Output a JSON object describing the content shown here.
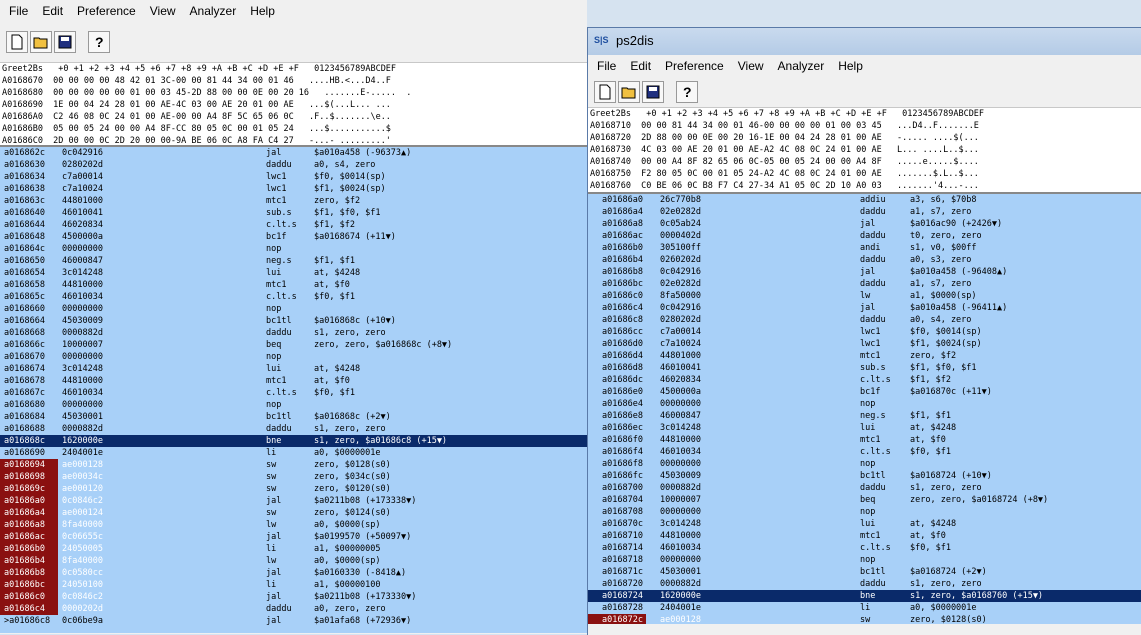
{
  "win1": {
    "title": "ps2dis",
    "menu": [
      "File",
      "Edit",
      "Preference",
      "View",
      "Analyzer",
      "Help"
    ],
    "hex_header": "Greet2Bs   +0 +1 +2 +3 +4 +5 +6 +7 +8 +9 +A +B +C +D +E +F   0123456789ABCDEF",
    "hex_rows": [
      "A0168670  00 00 00 00 48 42 01 3C-00 00 81 44 34 00 01 46   ....HB.<...D4..F",
      "A0168680  00 00 00 00 00 01 00 03 45-2D 88 00 00 0E 00 20 16   .......E-.....  .",
      "A0168690  1E 00 04 24 28 01 00 AE-4C 03 00 AE 20 01 00 AE   ...$(...L... ...",
      "A01686A0  C2 46 08 0C 24 01 00 AE-00 00 A4 8F 5C 65 06 0C   .F..$.......\\e..",
      "A01686B0  05 00 05 24 00 00 A4 8F-CC 80 05 0C 00 01 05 24   ...$...........$",
      "A01686C0  2D 00 00 0C 2D 20 00 00-9A BE 06 0C A8 FA C4 27   -...- .........'"
    ],
    "rows": [
      {
        "a": "a016862c",
        "h": "0c042916",
        "m": "jal",
        "o": "$a010a458 (-96373▲)"
      },
      {
        "a": "a0168630",
        "h": "0280202d",
        "m": "daddu",
        "o": "a0, s4, zero"
      },
      {
        "a": "a0168634",
        "h": "c7a00014",
        "m": "lwc1",
        "o": "$f0, $0014(sp)"
      },
      {
        "a": "a0168638",
        "h": "c7a10024",
        "m": "lwc1",
        "o": "$f1, $0024(sp)"
      },
      {
        "a": "a016863c",
        "h": "44801000",
        "m": "mtc1",
        "o": "zero, $f2"
      },
      {
        "a": "a0168640",
        "h": "46010041",
        "m": "sub.s",
        "o": "$f1, $f0, $f1"
      },
      {
        "a": "a0168644",
        "h": "46020834",
        "m": "c.lt.s",
        "o": "$f1, $f2"
      },
      {
        "a": "a0168648",
        "h": "4500000a",
        "m": "bc1f",
        "o": "$a0168674 (+11▼)"
      },
      {
        "a": "a016864c",
        "h": "00000000",
        "m": "nop",
        "o": ""
      },
      {
        "a": "a0168650",
        "h": "46000847",
        "m": "neg.s",
        "o": "$f1, $f1"
      },
      {
        "a": "a0168654",
        "h": "3c014248",
        "m": "lui",
        "o": "at, $4248"
      },
      {
        "a": "a0168658",
        "h": "44810000",
        "m": "mtc1",
        "o": "at, $f0"
      },
      {
        "a": "a016865c",
        "h": "46010034",
        "m": "c.lt.s",
        "o": "$f0, $f1"
      },
      {
        "a": "a0168660",
        "h": "00000000",
        "m": "nop",
        "o": ""
      },
      {
        "a": "a0168664",
        "h": "45030009",
        "m": "bc1tl",
        "o": "$a016868c (+10▼)"
      },
      {
        "a": "a0168668",
        "h": "0000882d",
        "m": "daddu",
        "o": "s1, zero, zero"
      },
      {
        "a": "a016866c",
        "h": "10000007",
        "m": "beq",
        "o": "zero, zero, $a016868c (+8▼)"
      },
      {
        "a": "a0168670",
        "h": "00000000",
        "m": "nop",
        "o": ""
      },
      {
        "a": "a0168674",
        "h": "3c014248",
        "m": "lui",
        "o": "at, $4248"
      },
      {
        "a": "a0168678",
        "h": "44810000",
        "m": "mtc1",
        "o": "at, $f0"
      },
      {
        "a": "a016867c",
        "h": "46010034",
        "m": "c.lt.s",
        "o": "$f0, $f1"
      },
      {
        "a": "a0168680",
        "h": "00000000",
        "m": "nop",
        "o": ""
      },
      {
        "a": "a0168684",
        "h": "45030001",
        "m": "bc1tl",
        "o": "$a016868c (+2▼)"
      },
      {
        "a": "a0168688",
        "h": "0000882d",
        "m": "daddu",
        "o": "s1, zero, zero"
      },
      {
        "a": "a016868c",
        "h": "1620000e",
        "m": "bne",
        "o": "s1, zero, $a01686c8 (+15▼)",
        "sel": true
      },
      {
        "a": "a0168690",
        "h": "2404001e",
        "m": "li",
        "o": "a0, $0000001e"
      },
      {
        "a": "a0168694",
        "h": "ae000128",
        "m": "sw",
        "o": "zero, $0128(s0)",
        "red": true
      },
      {
        "a": "a0168698",
        "h": "ae00034c",
        "m": "sw",
        "o": "zero, $034c(s0)",
        "red": true
      },
      {
        "a": "a016869c",
        "h": "ae000120",
        "m": "sw",
        "o": "zero, $0120(s0)",
        "red": true
      },
      {
        "a": "a01686a0",
        "h": "0c0846c2",
        "m": "jal",
        "o": "$a0211b08 (+173338▼)",
        "red": true
      },
      {
        "a": "a01686a4",
        "h": "ae000124",
        "m": "sw",
        "o": "zero, $0124(s0)",
        "red": true
      },
      {
        "a": "a01686a8",
        "h": "8fa40000",
        "m": "lw",
        "o": "a0, $0000(sp)",
        "red": true
      },
      {
        "a": "a01686ac",
        "h": "0c06655c",
        "m": "jal",
        "o": "$a0199570 (+50097▼)",
        "red": true
      },
      {
        "a": "a01686b0",
        "h": "24050005",
        "m": "li",
        "o": "a1, $00000005",
        "red": true
      },
      {
        "a": "a01686b4",
        "h": "8fa40000",
        "m": "lw",
        "o": "a0, $0000(sp)",
        "red": true
      },
      {
        "a": "a01686b8",
        "h": "0c0580cc",
        "m": "jal",
        "o": "$a0160330 (-8418▲)",
        "red": true
      },
      {
        "a": "a01686bc",
        "h": "24050100",
        "m": "li",
        "o": "a1, $00000100",
        "red": true
      },
      {
        "a": "a01686c0",
        "h": "0c0846c2",
        "m": "jal",
        "o": "$a0211b08 (+173330▼)",
        "red": true
      },
      {
        "a": "a01686c4",
        "h": "0000202d",
        "m": "daddu",
        "o": "a0, zero, zero",
        "red": true
      },
      {
        "a": ">a01686c8",
        "h": "0c06be9a",
        "m": "jal",
        "o": "$a01afa68 (+72936▼)"
      }
    ]
  },
  "win2": {
    "title": "ps2dis",
    "menu": [
      "File",
      "Edit",
      "Preference",
      "View",
      "Analyzer",
      "Help"
    ],
    "hex_header": "Greet2Bs   +0 +1 +2 +3 +4 +5 +6 +7 +8 +9 +A +B +C +D +E +F   0123456789ABCDEF",
    "hex_rows": [
      "A0168710  00 00 81 44 34 00 01 46-00 00 00 00 01 00 03 45   ...D4..F.......E",
      "A0168720  2D 88 00 00 0E 00 20 16-1E 00 04 24 28 01 00 AE   -..... ....$(...",
      "A0168730  4C 03 00 AE 20 01 00 AE-A2 4C 08 0C 24 01 00 AE   L... ....L..$...",
      "A0168740  00 00 A4 8F 82 65 06 0C-05 00 05 24 00 00 A4 8F   .....e.....$....",
      "A0168750  F2 80 05 0C 00 01 05 24-A2 4C 08 0C 24 01 00 AE   .......$.L..$...",
      "A0168760  C0 BE 06 0C B8 F7 C4 27-34 A1 05 0C 2D 10 A0 03   .......'4...-..."
    ],
    "rows": [
      {
        "a": "a01686a0",
        "h": "26c770b8",
        "m": "addiu",
        "o": "a3, s6, $70b8"
      },
      {
        "a": "a01686a4",
        "h": "02e0282d",
        "m": "daddu",
        "o": "a1, s7, zero"
      },
      {
        "a": "a01686a8",
        "h": "0c05ab24",
        "m": "jal",
        "o": "$a016ac90 (+2426▼)"
      },
      {
        "a": "a01686ac",
        "h": "0000402d",
        "m": "daddu",
        "o": "t0, zero, zero"
      },
      {
        "a": "a01686b0",
        "h": "305100ff",
        "m": "andi",
        "o": "s1, v0, $00ff"
      },
      {
        "a": "a01686b4",
        "h": "0260202d",
        "m": "daddu",
        "o": "a0, s3, zero"
      },
      {
        "a": "a01686b8",
        "h": "0c042916",
        "m": "jal",
        "o": "$a010a458 (-96408▲)"
      },
      {
        "a": "a01686bc",
        "h": "02e0282d",
        "m": "daddu",
        "o": "a1, s7, zero"
      },
      {
        "a": "a01686c0",
        "h": "8fa50000",
        "m": "lw",
        "o": "a1, $0000(sp)"
      },
      {
        "a": "a01686c4",
        "h": "0c042916",
        "m": "jal",
        "o": "$a010a458 (-96411▲)"
      },
      {
        "a": "a01686c8",
        "h": "0280202d",
        "m": "daddu",
        "o": "a0, s4, zero"
      },
      {
        "a": "a01686cc",
        "h": "c7a00014",
        "m": "lwc1",
        "o": "$f0, $0014(sp)"
      },
      {
        "a": "a01686d0",
        "h": "c7a10024",
        "m": "lwc1",
        "o": "$f1, $0024(sp)"
      },
      {
        "a": "a01686d4",
        "h": "44801000",
        "m": "mtc1",
        "o": "zero, $f2"
      },
      {
        "a": "a01686d8",
        "h": "46010041",
        "m": "sub.s",
        "o": "$f1, $f0, $f1"
      },
      {
        "a": "a01686dc",
        "h": "46020834",
        "m": "c.lt.s",
        "o": "$f1, $f2"
      },
      {
        "a": "a01686e0",
        "h": "4500000a",
        "m": "bc1f",
        "o": "$a016870c (+11▼)"
      },
      {
        "a": "a01686e4",
        "h": "00000000",
        "m": "nop",
        "o": ""
      },
      {
        "a": "a01686e8",
        "h": "46000847",
        "m": "neg.s",
        "o": "$f1, $f1"
      },
      {
        "a": "a01686ec",
        "h": "3c014248",
        "m": "lui",
        "o": "at, $4248"
      },
      {
        "a": "a01686f0",
        "h": "44810000",
        "m": "mtc1",
        "o": "at, $f0"
      },
      {
        "a": "a01686f4",
        "h": "46010034",
        "m": "c.lt.s",
        "o": "$f0, $f1"
      },
      {
        "a": "a01686f8",
        "h": "00000000",
        "m": "nop",
        "o": ""
      },
      {
        "a": "a01686fc",
        "h": "45030009",
        "m": "bc1tl",
        "o": "$a0168724 (+10▼)"
      },
      {
        "a": "a0168700",
        "h": "0000882d",
        "m": "daddu",
        "o": "s1, zero, zero"
      },
      {
        "a": "a0168704",
        "h": "10000007",
        "m": "beq",
        "o": "zero, zero, $a0168724 (+8▼)"
      },
      {
        "a": "a0168708",
        "h": "00000000",
        "m": "nop",
        "o": ""
      },
      {
        "a": "a016870c",
        "h": "3c014248",
        "m": "lui",
        "o": "at, $4248"
      },
      {
        "a": "a0168710",
        "h": "44810000",
        "m": "mtc1",
        "o": "at, $f0"
      },
      {
        "a": "a0168714",
        "h": "46010034",
        "m": "c.lt.s",
        "o": "$f0, $f1"
      },
      {
        "a": "a0168718",
        "h": "00000000",
        "m": "nop",
        "o": ""
      },
      {
        "a": "a016871c",
        "h": "45030001",
        "m": "bc1tl",
        "o": "$a0168724 (+2▼)"
      },
      {
        "a": "a0168720",
        "h": "0000882d",
        "m": "daddu",
        "o": "s1, zero, zero"
      },
      {
        "a": "a0168724",
        "h": "1620000e",
        "m": "bne",
        "o": "s1, zero, $a0168760 (+15▼)",
        "sel": true
      },
      {
        "a": "a0168728",
        "h": "2404001e",
        "m": "li",
        "o": "a0, $0000001e"
      },
      {
        "a": "a016872c",
        "h": "ae000128",
        "m": "sw",
        "o": "zero, $0128(s0)",
        "red": true
      }
    ]
  }
}
